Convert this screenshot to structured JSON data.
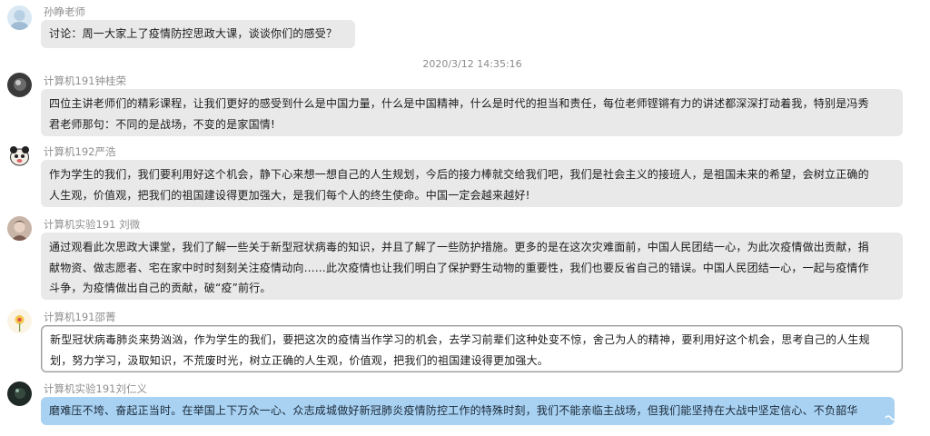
{
  "timestamp": "2020/3/12 14:35:16",
  "messages": [
    {
      "sender": "孙睁老师",
      "lines": [
        "讨论：周一大家上了疫情防控思政大课，谈谈你们的感受？"
      ]
    },
    {
      "sender": "计算机191钟桂荣",
      "lines": [
        "四位主讲老师们的精彩课程，让我们更好的感受到什么是中国力量，什么是中国精神，什么是时代的担当和责任，每位老师铿锵有力的讲述都深深打动着我，特别是冯秀",
        "君老师那句：不同的是战场，不变的是家国情!"
      ]
    },
    {
      "sender": "计算机192严浩",
      "lines": [
        "作为学生的我们，我们要利用好这个机会，静下心来想一想自己的人生规划，今后的接力棒就交给我们吧，我们是社会主义的接班人，是祖国未来的希望，会树立正确的",
        "人生观，价值观，把我们的祖国建设得更加强大，是我们每个人的终生使命。中国一定会越来越好!"
      ]
    },
    {
      "sender": "计算机实验191 刘微",
      "lines": [
        "通过观看此次思政大课堂，我们了解一些关于新型冠状病毒的知识，并且了解了一些防护措施。更多的是在这次灾难面前，中国人民团结一心，为此次疫情做出贡献，捐",
        "献物资、做志愿者、宅在家中时时刻刻关注疫情动向……此次疫情也让我们明白了保护野生动物的重要性，我们也要反省自己的错误。中国人民团结一心，一起与疫情作",
        "斗争，为疫情做出自己的贡献，破“疫”前行。"
      ]
    },
    {
      "sender": "计算机191邵菁",
      "lines": [
        "新型冠状病毒肺炎来势汹汹，作为学生的我们，要把这次的疫情当作学习的机会，去学习前辈们这种处变不惊，舍己为人的精神，要利用好这个机会，思考自己的人生规",
        "划，努力学习，汲取知识，不荒废时光，树立正确的人生观，价值观，把我们的祖国建设得更加强大。"
      ]
    },
    {
      "sender": "计算机实验191刘仁义",
      "lines": [
        "磨难压不垮、奋起正当时。在举国上下万众一心、众志成城做好新冠肺炎疫情防控工作的特殊时刻，我们不能亲临主战场，但我们能坚持在大战中坚定信心、不负韶华"
      ]
    }
  ],
  "colors": {
    "bubble": "#e9e9e9",
    "selected_bubble": "#a9d2f2",
    "sender_text": "#8f8f8f"
  }
}
